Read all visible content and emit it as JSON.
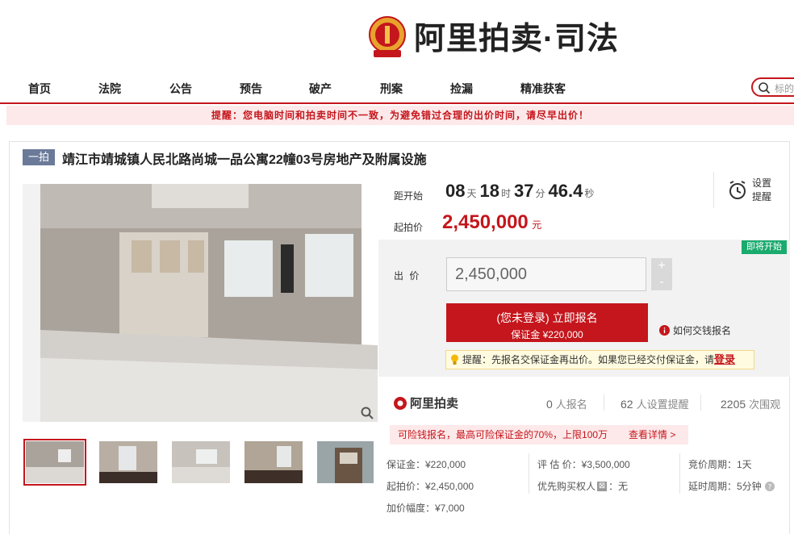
{
  "header": {
    "brand": "阿里拍卖·司法",
    "nav": [
      "首页",
      "法院",
      "公告",
      "预告",
      "破产",
      "刑案",
      "捡漏",
      "精准获客"
    ],
    "search_placeholder": "标的物"
  },
  "notice": "提醒：您电脑时间和拍卖时间不一致，为避免错过合理的出价时间，请尽早出价！",
  "item": {
    "tag": "一拍",
    "title": "靖江市靖城镇人民北路尚城一品公寓22幢03号房地产及附属设施"
  },
  "countdown": {
    "label": "距开始",
    "days": "08",
    "days_unit": "天",
    "hours": "18",
    "hours_unit": "时",
    "minutes": "37",
    "minutes_unit": "分",
    "seconds": "46.4",
    "seconds_unit": "秒"
  },
  "reminder": {
    "line1": "设置",
    "line2": "提醒"
  },
  "start_price": {
    "label": "起拍价",
    "value": "2,450,000",
    "unit": "元"
  },
  "status_badge": "即将开始",
  "bid": {
    "label": "出 价",
    "value": "2,450,000",
    "plus": "+",
    "minus": "-"
  },
  "register": {
    "line1": "(您未登录) 立即报名",
    "line2": "保证金 ¥220,000"
  },
  "how_pay": "如何交钱报名",
  "tip": {
    "text": "提醒：先报名交保证金再出价。如果您已经交付保证金，请",
    "link": "登录"
  },
  "platform": "阿里拍卖",
  "stats": [
    {
      "num": "0",
      "label": "人报名"
    },
    {
      "num": "62",
      "label": "人设置提醒"
    },
    {
      "num": "2205",
      "label": "次围观"
    }
  ],
  "promo": {
    "text": "可险钱报名，最高可险保证金的70%，上限100万",
    "link": "查看详情 >"
  },
  "details": {
    "deposit": "保证金：¥220,000",
    "start": "起拍价：¥2,450,000",
    "increment": "加价幅度：¥7,000",
    "appraisal": "评 估 价：¥3,500,000",
    "priority_label": "优先购买权人",
    "priority_badge": "⊠",
    "priority_value": "：无",
    "cycle": "竞价周期：1天",
    "delay": "延时周期：5分钟"
  },
  "colors": {
    "accent": "#c4161c",
    "green": "#1aab6e",
    "tag": "#6b7a99"
  }
}
